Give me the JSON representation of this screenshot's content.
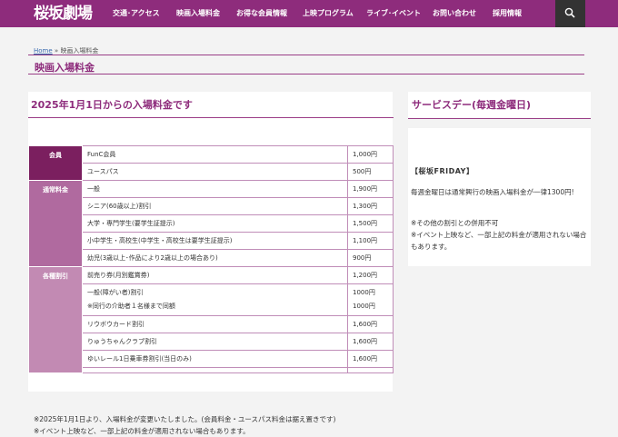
{
  "header": {
    "logo": "桜坂劇場",
    "nav": [
      "交通･アクセス",
      "映画入場料金",
      "お得な会員情報",
      "上映プログラム",
      "ライブ･イベント",
      "お問い合わせ",
      "採用情報"
    ]
  },
  "breadcrumb": {
    "home": "Home",
    "separator": "»",
    "current": "映画入場料金"
  },
  "page_title": "映画入場料金",
  "main": {
    "heading": "2025年1月1日からの入場料金です",
    "categories": {
      "member": "会員",
      "regular": "通常料金",
      "discount": "各種割引"
    },
    "rows": {
      "funC": {
        "name": "FunC会員",
        "price": "1,000円"
      },
      "youth": {
        "name": "ユースパス",
        "price": "500円"
      },
      "general": {
        "name": "一般",
        "price": "1,900円"
      },
      "senior": {
        "name": "シニア(60歳以上)割引",
        "price": "1,300円"
      },
      "college": {
        "name": "大学・専門学生(要学生証提示)",
        "price": "1,500円"
      },
      "school": {
        "name": "小中学生・高校生(中学生・高校生は要学生証提示)",
        "price": "1,100円"
      },
      "infant": {
        "name": "幼児(3歳以上･作品により2歳以上の場合あり)",
        "price": "900円"
      },
      "advance": {
        "name": "前売り券(月別鑑賞券)",
        "price": "1,200円"
      },
      "disability1": {
        "name": "一般(障がい者)割引",
        "price": "1000円"
      },
      "disability2": {
        "name": "※同行の介助者１名様まで同額",
        "price": "1000円"
      },
      "ryubo": {
        "name": "リウボウカード割引",
        "price": "1,600円"
      },
      "ryuchan": {
        "name": "りゅうちゃんクラブ割引",
        "price": "1,600円"
      },
      "yuirail": {
        "name": "ゆいレール1日乗車券割引(当日のみ)",
        "price": "1,600円"
      }
    },
    "notes": [
      "※2025年1月1日より、入場料金が変更いたしました。(会員料金・ユースパス料金は据え置きです)",
      "※イベント上映など、一部上記の料金が適用されない場合もあります。"
    ]
  },
  "sidebar": {
    "heading": "サービスデー(毎週金曜日)",
    "label": "【桜坂FRIDAY】",
    "text1": "毎週金曜日は通常興行の映画入場料金が一律1300円!",
    "text2": "※その他の割引との併用不可",
    "text3": "※イベント上映など、一部上記の料金が適用されない場合もあります。"
  },
  "colors": {
    "brand": "#8e2c7c",
    "search_bg": "#333333",
    "member_cell": "#7b1f5f",
    "regular_cell": "#b06a9f",
    "discount_cell": "#c28ab3"
  },
  "icons": {
    "search": "search-icon"
  }
}
